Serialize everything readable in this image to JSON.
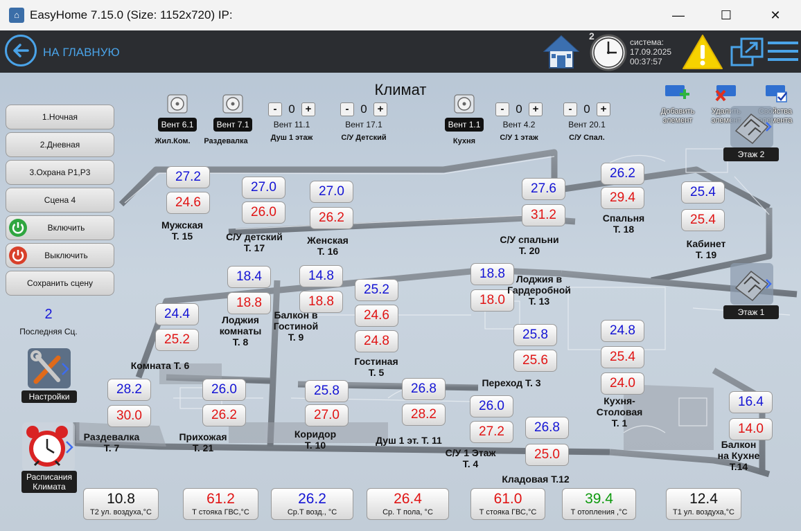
{
  "window": {
    "title": "EasyHome 7.15.0 (Size: 1152x720) IP:",
    "minimize": "—",
    "maximize": "☐",
    "close": "✕"
  },
  "topbar": {
    "back_label": "НА ГЛАВНУЮ",
    "badge": "2",
    "system_label": "система:",
    "date": "17.09.2025",
    "time": "00:37:57"
  },
  "page_title": "Климат",
  "left_panel": {
    "buttons": [
      "1.Ночная",
      "2.Дневная",
      "3.Охрана Р1,Р3",
      "Сцена 4"
    ],
    "on_label": "Включить",
    "off_label": "Выключить",
    "save_label": "Сохранить сцену",
    "last_scene_value": "2",
    "last_scene_label": "Последняя Сц.",
    "settings_label": "Настройки",
    "schedule_label": "Расписания Климата"
  },
  "vents": [
    {
      "tag": "Вент 6.1",
      "caption": "Жил.Ком."
    },
    {
      "tag": "Вент 7.1",
      "caption": "Раздевалка"
    },
    {
      "tag": "Вент 1.1",
      "caption": "Кухня"
    }
  ],
  "steppers": [
    {
      "value": "0",
      "name": "Вент 11.1",
      "caption": "Душ 1 этаж"
    },
    {
      "value": "0",
      "name": "Вент 17.1",
      "caption": "С/У Детский"
    },
    {
      "value": "0",
      "name": "Вент 4.2",
      "caption": "С/У 1 этаж"
    },
    {
      "value": "0",
      "name": "Вент 20.1",
      "caption": "С/У Спал."
    }
  ],
  "stepper_minus": "-",
  "stepper_plus": "+",
  "tools": {
    "add": "Добавить элемент",
    "delete": "Удалить элемент",
    "props": "Свойства элемента",
    "floor2": "Этаж 2",
    "floor1": "Этаж 1"
  },
  "rooms": [
    {
      "name": "Мужская\nТ. 15",
      "set": "27.2",
      "actual": "24.6"
    },
    {
      "name": "С/У детский\nТ. 17",
      "set": "27.0",
      "actual": "26.0"
    },
    {
      "name": "Женская\nТ. 16",
      "set": "27.0",
      "actual": "26.2"
    },
    {
      "name": "С/У спальни\nТ. 20",
      "set": "27.6",
      "actual": "31.2"
    },
    {
      "name": "Спальня\nТ. 18",
      "set": "26.2",
      "actual": "29.4"
    },
    {
      "name": "Кабинет\nТ. 19",
      "set": "25.4",
      "actual": "25.4"
    },
    {
      "name": "Лоджия\nкомнаты\nТ. 8",
      "set": "18.4",
      "actual": "18.8"
    },
    {
      "name": "Балкон в\nГостиной\nТ. 9",
      "set": "14.8",
      "actual": "18.8"
    },
    {
      "name": "Гостиная\nТ. 5",
      "set": "25.2",
      "actual": "24.6",
      "extra": "24.8"
    },
    {
      "name": "Лоджия в\nГардеробной\nТ. 13",
      "set": "18.8",
      "actual": "18.0"
    },
    {
      "name": "Комната Т. 6",
      "set": "24.4",
      "actual": "25.2"
    },
    {
      "name": "Переход Т. 3",
      "set": "25.8",
      "actual": "25.6"
    },
    {
      "name": "Кухня-\nСтоловая\nТ. 1",
      "set": "24.8",
      "actual": "25.4",
      "extra": "24.0"
    },
    {
      "name": "Раздевалка\nТ. 7",
      "set": "28.2",
      "actual": "30.0"
    },
    {
      "name": "Прихожая\nТ. 21",
      "set": "26.0",
      "actual": "26.2"
    },
    {
      "name": "Коридор\nТ. 10",
      "set": "25.8",
      "actual": "27.0"
    },
    {
      "name": "Душ 1 эт. Т. 11",
      "set": "26.8",
      "actual": "28.2"
    },
    {
      "name": "С/У 1 Этаж\nТ. 4",
      "set": "26.0",
      "actual": "27.2"
    },
    {
      "name": "Кладовая Т.12",
      "set": "26.8",
      "actual": "25.0"
    },
    {
      "name": "Балкон\nна Кухне\nТ.14",
      "set": "16.4",
      "actual": "14.0"
    }
  ],
  "sensors": [
    {
      "value": "10.8",
      "label": "Т2 ул. воздуха,°С",
      "color": "#111111"
    },
    {
      "value": "61.2",
      "label": "Т стояка ГВС,°С",
      "color": "#e01414"
    },
    {
      "value": "26.2",
      "label": "Ср.Т возд., °С",
      "color": "#1414d4"
    },
    {
      "value": "26.4",
      "label": "Ср. Т пола, °С",
      "color": "#e01414"
    },
    {
      "value": "61.0",
      "label": "Т стояка ГВС,°С",
      "color": "#e01414"
    },
    {
      "value": "39.4",
      "label": "Т отопления ,°С",
      "color": "#0f9a0f"
    },
    {
      "value": "12.4",
      "label": "Т1 ул. воздуха,°С",
      "color": "#111111"
    }
  ],
  "colors": {
    "set_temp": "#1414d4",
    "actual_temp": "#e01414",
    "accent": "#4aa3e8",
    "topbar": "#2b2d31"
  }
}
